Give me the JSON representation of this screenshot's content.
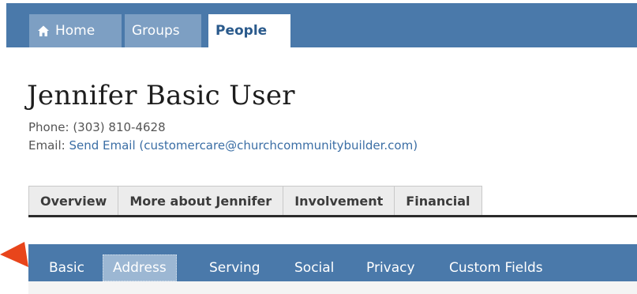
{
  "topnav": {
    "tabs": [
      {
        "label": "Home",
        "icon": "home-icon"
      },
      {
        "label": "Groups"
      },
      {
        "label": "People",
        "active": true
      }
    ]
  },
  "profile": {
    "name": "Jennifer Basic User",
    "phone_label": "Phone:",
    "phone": "(303) 810-4628",
    "email_label": "Email:",
    "email_link": "Send Email",
    "email_address": "(customercare@churchcommunitybuilder.com)"
  },
  "profile_tabs": [
    "Overview",
    "More about Jennifer",
    "Involvement",
    "Financial"
  ],
  "subnav": {
    "tabs": [
      "Basic",
      "Address",
      "Serving",
      "Social",
      "Privacy",
      "Custom Fields"
    ],
    "active": "Address"
  },
  "colors": {
    "nav_blue": "#4a79aa",
    "inactive_tab": "#7d9fc3",
    "active_subtab": "#9cb7d3",
    "link": "#3b6ea5",
    "callout_arrow": "#e8451b"
  }
}
